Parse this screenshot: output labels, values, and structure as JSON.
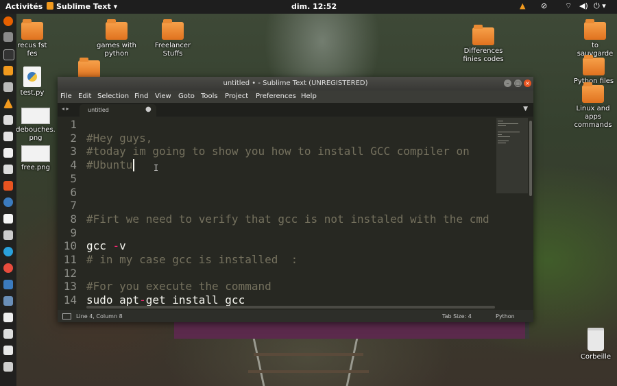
{
  "topbar": {
    "activities": "Activités",
    "app_name": "Sublime Text",
    "app_menu_arrow": "▾",
    "clock": "dim. 12:52",
    "tray_icons": [
      "vlc-icon",
      "update-icon",
      "network-icon",
      "volume-icon",
      "power-icon"
    ]
  },
  "dock": {
    "icons": [
      "firefox-icon",
      "files-icon",
      "terminal-icon",
      "sublime-icon",
      "photos-icon",
      "vlc-icon",
      "text-editor-icon",
      "software-icon",
      "libreoffice-icon",
      "store-icon",
      "help-icon",
      "amazon-icon",
      "app-icon",
      "skype-icon",
      "chrome-icon",
      "mail-icon",
      "monitor-icon",
      "calc-icon",
      "document-icon",
      "terminal2-icon",
      "document2-icon",
      "settings-icon"
    ]
  },
  "desktop": {
    "items": [
      {
        "label": "recus fst\nfes",
        "kind": "folder"
      },
      {
        "label": "games with\npython",
        "kind": "folder"
      },
      {
        "label": "Freelancer\nStuffs",
        "kind": "folder"
      },
      {
        "label": "Differences\nfinies codes",
        "kind": "folder"
      },
      {
        "label": "to\nsauvgarde",
        "kind": "folder"
      },
      {
        "label": "Python files\nstuffs",
        "kind": "folder"
      },
      {
        "label": "Linux and\napps\ncommands",
        "kind": "folder"
      },
      {
        "label": "test.py",
        "kind": "python"
      },
      {
        "label": "debouches.\npng",
        "kind": "image"
      },
      {
        "label": "free.png",
        "kind": "image"
      },
      {
        "label": "Corbeille",
        "kind": "trash"
      }
    ]
  },
  "window": {
    "title": "untitled • - Sublime Text (UNREGISTERED)",
    "menu": [
      "File",
      "Edit",
      "Selection",
      "Find",
      "View",
      "Goto",
      "Tools",
      "Project",
      "Preferences",
      "Help"
    ],
    "tab": {
      "name": "untitled",
      "dot": "●"
    },
    "tab_arrows": "◂ ▸",
    "tab_dropdown": "▼",
    "buttons": {
      "minimize": "–",
      "maximize": "□",
      "close": "×"
    },
    "lines": [
      {
        "n": "1",
        "text": "",
        "style": "plain"
      },
      {
        "n": "2",
        "text": "#Hey guys,",
        "style": "cm"
      },
      {
        "n": "3",
        "text": "#today im going to show you how to install GCC compiler on",
        "style": "cm"
      },
      {
        "n": "4",
        "text": "#Ubuntu",
        "style": "cm"
      },
      {
        "n": "5",
        "text": "",
        "style": "plain"
      },
      {
        "n": "6",
        "text": "",
        "style": "plain"
      },
      {
        "n": "7",
        "text": "",
        "style": "plain"
      },
      {
        "n": "8",
        "text": "#Firt we need to verify that gcc is not instaled with the cmd",
        "style": "cm"
      },
      {
        "n": "9",
        "text": "",
        "style": "plain"
      },
      {
        "n": "10",
        "parts": [
          {
            "t": "gcc ",
            "s": "plain"
          },
          {
            "t": "-",
            "s": "kw"
          },
          {
            "t": "v",
            "s": "plain"
          }
        ]
      },
      {
        "n": "11",
        "text": "# in my case gcc is installed  :",
        "style": "cm"
      },
      {
        "n": "12",
        "text": "",
        "style": "plain"
      },
      {
        "n": "13",
        "text": "#For you execute the command",
        "style": "cm"
      },
      {
        "n": "14",
        "parts": [
          {
            "t": "sudo apt",
            "s": "plain"
          },
          {
            "t": "-",
            "s": "kw"
          },
          {
            "t": "get install gcc",
            "s": "plain"
          }
        ]
      }
    ],
    "status": {
      "position": "Line 4, Column 8",
      "tab_size": "Tab Size: 4",
      "syntax": "Python"
    }
  }
}
